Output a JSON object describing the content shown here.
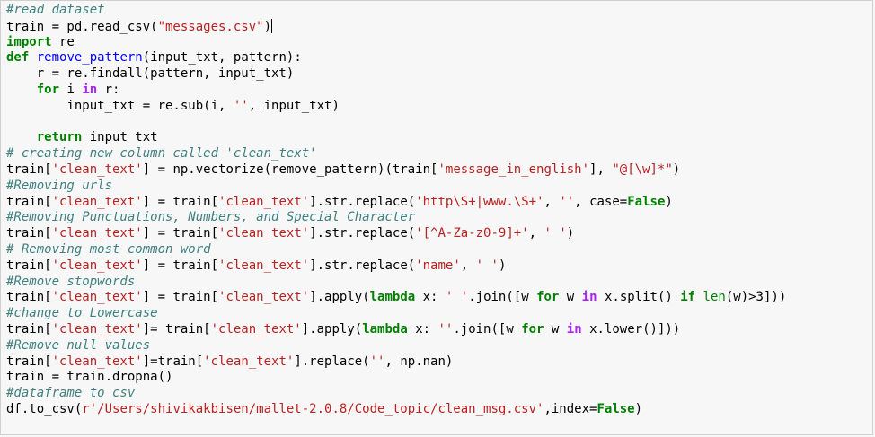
{
  "editor": {
    "lines": [
      [
        {
          "t": "#read dataset",
          "c": "c"
        }
      ],
      [
        {
          "t": "train = pd.read_csv(",
          "c": ""
        },
        {
          "t": "\"messages.csv\"",
          "c": "s"
        },
        {
          "t": ")",
          "c": ""
        },
        {
          "t": "",
          "c": "caret"
        }
      ],
      [
        {
          "t": "import",
          "c": "k"
        },
        {
          "t": " re",
          "c": ""
        }
      ],
      [
        {
          "t": "def",
          "c": "k"
        },
        {
          "t": " ",
          "c": ""
        },
        {
          "t": "remove_pattern",
          "c": "f"
        },
        {
          "t": "(input_txt, pattern):",
          "c": ""
        }
      ],
      [
        {
          "t": "    r = re.findall(pattern, input_txt)",
          "c": ""
        }
      ],
      [
        {
          "t": "    ",
          "c": ""
        },
        {
          "t": "for",
          "c": "k"
        },
        {
          "t": " i ",
          "c": ""
        },
        {
          "t": "in",
          "c": "o"
        },
        {
          "t": " r:",
          "c": ""
        }
      ],
      [
        {
          "t": "        input_txt = re.sub(i, ",
          "c": ""
        },
        {
          "t": "''",
          "c": "s"
        },
        {
          "t": ", input_txt)",
          "c": ""
        }
      ],
      [
        {
          "t": "",
          "c": ""
        }
      ],
      [
        {
          "t": "    ",
          "c": ""
        },
        {
          "t": "return",
          "c": "k"
        },
        {
          "t": " input_txt",
          "c": ""
        }
      ],
      [
        {
          "t": "# creating new column called 'clean_text'",
          "c": "c"
        }
      ],
      [
        {
          "t": "train[",
          "c": ""
        },
        {
          "t": "'clean_text'",
          "c": "s"
        },
        {
          "t": "] = np.vectorize(remove_pattern)(train[",
          "c": ""
        },
        {
          "t": "'message_in_english'",
          "c": "s"
        },
        {
          "t": "], ",
          "c": ""
        },
        {
          "t": "\"@[\\w]*\"",
          "c": "s"
        },
        {
          "t": ")",
          "c": ""
        }
      ],
      [
        {
          "t": "#Removing urls",
          "c": "c"
        }
      ],
      [
        {
          "t": "train[",
          "c": ""
        },
        {
          "t": "'clean_text'",
          "c": "s"
        },
        {
          "t": "] = train[",
          "c": ""
        },
        {
          "t": "'clean_text'",
          "c": "s"
        },
        {
          "t": "].str.replace(",
          "c": ""
        },
        {
          "t": "'http\\S+|www.\\S+'",
          "c": "s"
        },
        {
          "t": ", ",
          "c": ""
        },
        {
          "t": "''",
          "c": "s"
        },
        {
          "t": ", case=",
          "c": ""
        },
        {
          "t": "False",
          "c": "k"
        },
        {
          "t": ")",
          "c": ""
        }
      ],
      [
        {
          "t": "#Removing Punctuations, Numbers, and Special Character",
          "c": "c"
        }
      ],
      [
        {
          "t": "train[",
          "c": ""
        },
        {
          "t": "'clean_text'",
          "c": "s"
        },
        {
          "t": "] = train[",
          "c": ""
        },
        {
          "t": "'clean_text'",
          "c": "s"
        },
        {
          "t": "].str.replace(",
          "c": ""
        },
        {
          "t": "'[^A-Za-z0-9]+'",
          "c": "s"
        },
        {
          "t": ", ",
          "c": ""
        },
        {
          "t": "' '",
          "c": "s"
        },
        {
          "t": ")",
          "c": ""
        }
      ],
      [
        {
          "t": "# Removing most common word",
          "c": "c"
        }
      ],
      [
        {
          "t": "train[",
          "c": ""
        },
        {
          "t": "'clean_text'",
          "c": "s"
        },
        {
          "t": "] = train[",
          "c": ""
        },
        {
          "t": "'clean_text'",
          "c": "s"
        },
        {
          "t": "].str.replace(",
          "c": ""
        },
        {
          "t": "'name'",
          "c": "s"
        },
        {
          "t": ", ",
          "c": ""
        },
        {
          "t": "' '",
          "c": "s"
        },
        {
          "t": ")",
          "c": ""
        }
      ],
      [
        {
          "t": "#Remove stopwords",
          "c": "c"
        }
      ],
      [
        {
          "t": "train[",
          "c": ""
        },
        {
          "t": "'clean_text'",
          "c": "s"
        },
        {
          "t": "] = train[",
          "c": ""
        },
        {
          "t": "'clean_text'",
          "c": "s"
        },
        {
          "t": "].apply(",
          "c": ""
        },
        {
          "t": "lambda",
          "c": "k"
        },
        {
          "t": " x: ",
          "c": ""
        },
        {
          "t": "' '",
          "c": "s"
        },
        {
          "t": ".join([w ",
          "c": ""
        },
        {
          "t": "for",
          "c": "k"
        },
        {
          "t": " w ",
          "c": ""
        },
        {
          "t": "in",
          "c": "o"
        },
        {
          "t": " x.split() ",
          "c": ""
        },
        {
          "t": "if",
          "c": "k"
        },
        {
          "t": " ",
          "c": ""
        },
        {
          "t": "len",
          "c": "b"
        },
        {
          "t": "(w)>3]))",
          "c": ""
        }
      ],
      [
        {
          "t": "#change to Lowercase",
          "c": "c"
        }
      ],
      [
        {
          "t": "train[",
          "c": ""
        },
        {
          "t": "'clean_text'",
          "c": "s"
        },
        {
          "t": "]= train[",
          "c": ""
        },
        {
          "t": "'clean_text'",
          "c": "s"
        },
        {
          "t": "].apply(",
          "c": ""
        },
        {
          "t": "lambda",
          "c": "k"
        },
        {
          "t": " x: ",
          "c": ""
        },
        {
          "t": "''",
          "c": "s"
        },
        {
          "t": ".join([w ",
          "c": ""
        },
        {
          "t": "for",
          "c": "k"
        },
        {
          "t": " w ",
          "c": ""
        },
        {
          "t": "in",
          "c": "o"
        },
        {
          "t": " x.lower()]))",
          "c": ""
        }
      ],
      [
        {
          "t": "#Remove null values",
          "c": "c"
        }
      ],
      [
        {
          "t": "train[",
          "c": ""
        },
        {
          "t": "'clean_text'",
          "c": "s"
        },
        {
          "t": "]=train[",
          "c": ""
        },
        {
          "t": "'clean_text'",
          "c": "s"
        },
        {
          "t": "].replace(",
          "c": ""
        },
        {
          "t": "''",
          "c": "s"
        },
        {
          "t": ", np.nan)",
          "c": ""
        }
      ],
      [
        {
          "t": "train = train.dropna()",
          "c": ""
        }
      ],
      [
        {
          "t": "#dataframe to csv",
          "c": "c"
        }
      ],
      [
        {
          "t": "df.to_csv(",
          "c": ""
        },
        {
          "t": "r'/Users/shivikakbisen/mallet-2.0.8/Code_topic/clean_msg.csv'",
          "c": "s"
        },
        {
          "t": ",index=",
          "c": ""
        },
        {
          "t": "False",
          "c": "k"
        },
        {
          "t": ")",
          "c": ""
        }
      ]
    ]
  },
  "colors": {
    "background": "#f7f7f7",
    "comment": "#408080",
    "string": "#ba2121",
    "keyword": "#008000",
    "operator_keyword": "#aa22ff",
    "function_name": "#0000ff"
  }
}
